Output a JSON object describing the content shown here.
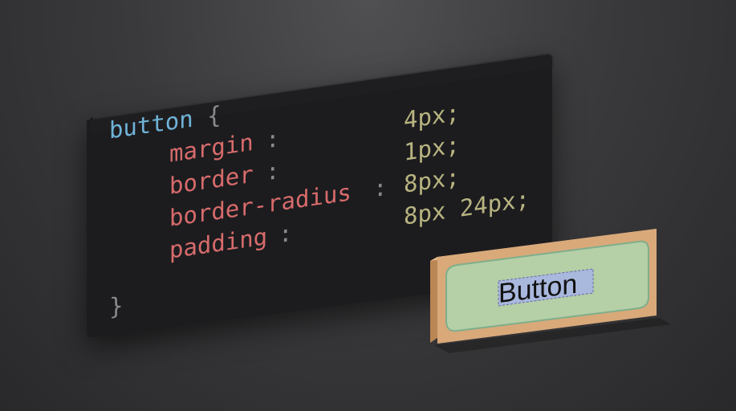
{
  "code": {
    "selector": "button",
    "open_brace": "{",
    "close_brace": "}",
    "properties": [
      {
        "name": "margin",
        "colon": ":",
        "value": "4px;"
      },
      {
        "name": "border",
        "colon": ":",
        "value": "1px;"
      },
      {
        "name": "border-radius",
        "colon": ":",
        "value": "8px;"
      },
      {
        "name": "padding",
        "colon": ":",
        "value": "8px 24px;"
      }
    ]
  },
  "preview": {
    "label": "Button"
  },
  "colors": {
    "selector": "#6fb3d8",
    "property": "#d76b6b",
    "value": "#b8b480",
    "punctuation": "#8a8a8a",
    "panel": "#1e1e21",
    "margin_box": "#d9a97a",
    "border_line": "#7fae8c",
    "padding_box": "#b5cfa7",
    "content_box": "#a9b8dd"
  }
}
